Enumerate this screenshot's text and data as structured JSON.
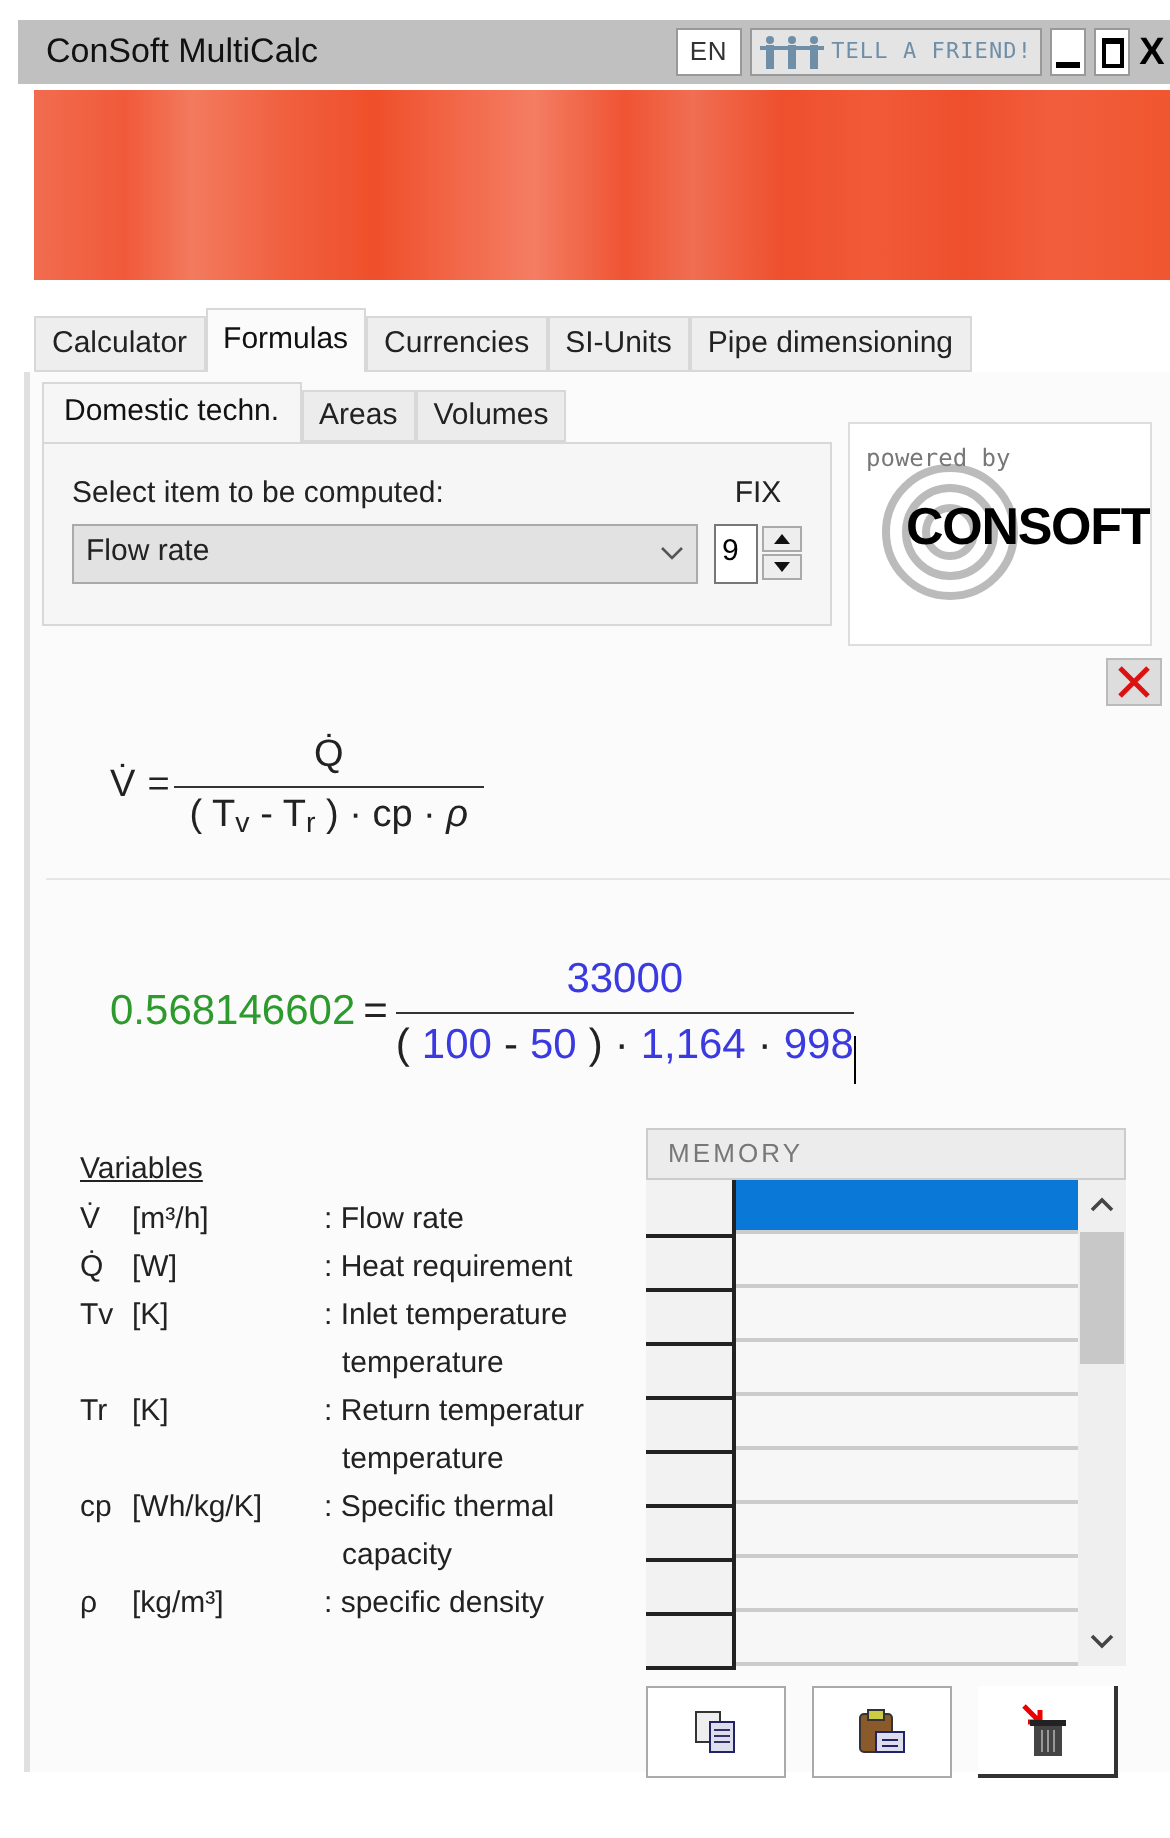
{
  "window": {
    "title": "ConSoft MultiCalc",
    "language": "EN",
    "tell_a_friend": "TELL A FRIEND!",
    "close": "X"
  },
  "tabs": [
    {
      "label": "Calculator",
      "selected": false
    },
    {
      "label": "Formulas",
      "selected": true
    },
    {
      "label": "Currencies",
      "selected": false
    },
    {
      "label": "SI-Units",
      "selected": false
    },
    {
      "label": "Pipe dimensioning",
      "selected": false
    }
  ],
  "subtabs": [
    {
      "label": "Domestic techn.",
      "selected": true
    },
    {
      "label": "Areas",
      "selected": false
    },
    {
      "label": "Volumes",
      "selected": false
    }
  ],
  "select": {
    "label": "Select item to be computed:",
    "value": "Flow rate"
  },
  "fix": {
    "label": "FIX",
    "value": "9"
  },
  "logo": {
    "tagline": "powered by",
    "name": "CONSOFT"
  },
  "formula": {
    "lhs": "V̇",
    "equals": "=",
    "numerator": "Q̇",
    "denominator": "( T$_{v}$ - T$_{r}$ ) · cp · *ρ*"
  },
  "result": {
    "value": "0.568146602",
    "equals": "=",
    "numerator": "33000",
    "denominator": [
      {
        "text": "(",
        "kind": "op"
      },
      {
        "text": "100",
        "kind": "value"
      },
      {
        "text": "-",
        "kind": "op"
      },
      {
        "text": "50",
        "kind": "value"
      },
      {
        "text": ")",
        "kind": "op"
      },
      {
        "text": "·",
        "kind": "op"
      },
      {
        "text": "1,164",
        "kind": "value"
      },
      {
        "text": "·",
        "kind": "op"
      },
      {
        "text": "998",
        "kind": "value"
      }
    ]
  },
  "variables": {
    "heading": "Variables",
    "items": [
      {
        "symbol": "V̇",
        "unit": "[m³/h]",
        "lines": [
          ": Flow rate"
        ]
      },
      {
        "symbol": "Q̇",
        "unit": "[W]",
        "lines": [
          ": Heat requirement"
        ]
      },
      {
        "symbol": "Tv",
        "unit": "[K]",
        "lines": [
          ": Inlet temperature",
          "temperature"
        ]
      },
      {
        "symbol": "Tr",
        "unit": "[K]",
        "lines": [
          ": Return temperatur",
          "temperature"
        ]
      },
      {
        "symbol": "cp",
        "unit": "[Wh/kg/K]",
        "lines": [
          ": Specific thermal",
          "capacity"
        ]
      },
      {
        "symbol": "ρ",
        "unit": "[kg/m³]",
        "lines": [
          ": specific density"
        ]
      }
    ]
  },
  "memory": {
    "title": "MEMORY",
    "rows": [
      {
        "selected": true
      },
      {
        "selected": false
      },
      {
        "selected": false
      },
      {
        "selected": false
      },
      {
        "selected": false
      },
      {
        "selected": false
      },
      {
        "selected": false
      },
      {
        "selected": false
      },
      {
        "selected": false
      }
    ]
  }
}
